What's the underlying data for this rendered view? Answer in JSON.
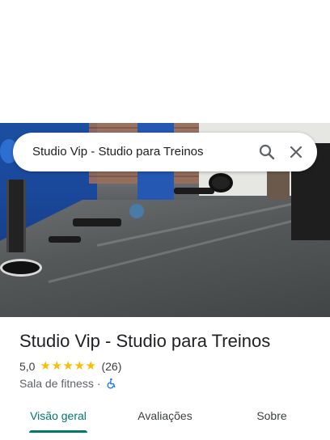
{
  "search": {
    "query": "Studio Vip - Studio para Treinos"
  },
  "place": {
    "name": "Studio Vip - Studio para Treinos",
    "rating": "5,0",
    "stars": 5,
    "reviews": "(26)",
    "category": "Sala de fitness",
    "separator": "·"
  },
  "tabs": [
    {
      "label": "Visão geral",
      "active": true
    },
    {
      "label": "Avaliações",
      "active": false
    },
    {
      "label": "Sobre",
      "active": false
    }
  ],
  "colors": {
    "accent": "#00796b",
    "star": "#fbbc04",
    "wheelchair": "#1a73e8"
  },
  "icons": {
    "search": "search-icon",
    "close": "close-icon",
    "accessibility": "wheelchair-icon"
  }
}
